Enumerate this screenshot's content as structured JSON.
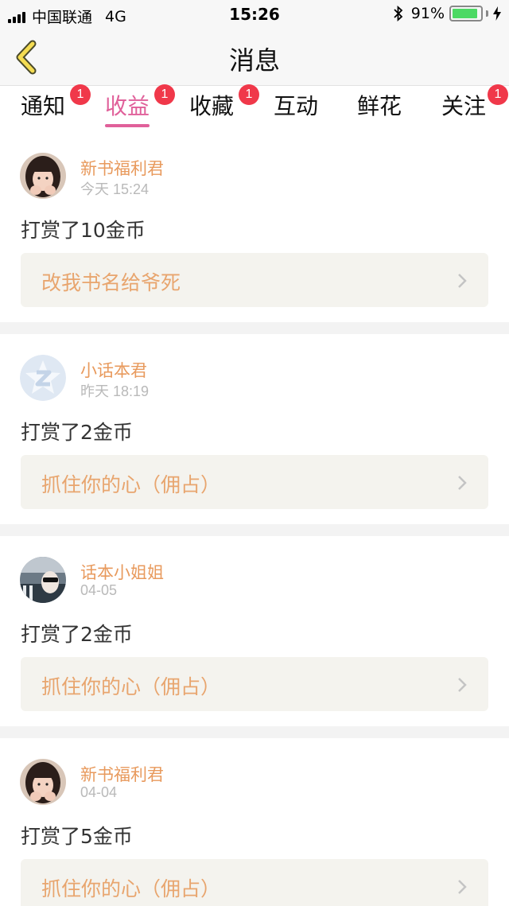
{
  "status_bar": {
    "carrier": "中国联通",
    "network": "4G",
    "time": "15:26",
    "battery": "91%",
    "battery_level": 0.91
  },
  "nav": {
    "title": "消息"
  },
  "tabs": [
    {
      "label": "通知",
      "badge": "1",
      "active": false
    },
    {
      "label": "收益",
      "badge": "1",
      "active": true
    },
    {
      "label": "收藏",
      "badge": "1",
      "active": false
    },
    {
      "label": "互动",
      "badge": "",
      "active": false
    },
    {
      "label": "鲜花",
      "badge": "",
      "active": false
    },
    {
      "label": "关注",
      "badge": "1",
      "active": false
    }
  ],
  "feed": [
    {
      "name": "新书福利君",
      "time": "今天 15:24",
      "action": "打赏了10金币",
      "book": "改我书名给爷死",
      "avatar": "girl-avatar-icon"
    },
    {
      "name": "小话本君",
      "time": "昨天 18:19",
      "action": "打赏了2金币",
      "book": "抓住你的心（佣占）",
      "avatar": "z-logo-avatar-icon"
    },
    {
      "name": "话本小姐姐",
      "time": "04-05",
      "action": "打赏了2金币",
      "book": "抓住你的心（佣占）",
      "avatar": "sunglasses-avatar-icon"
    },
    {
      "name": "新书福利君",
      "time": "04-04",
      "action": "打赏了5金币",
      "book": "抓住你的心（佣占）",
      "avatar": "girl-avatar-icon"
    }
  ],
  "colors": {
    "accent": "#e0609a",
    "name": "#e89a5d",
    "book": "#e8a56e",
    "badge": "#f0384a",
    "battery": "#4cd964"
  }
}
